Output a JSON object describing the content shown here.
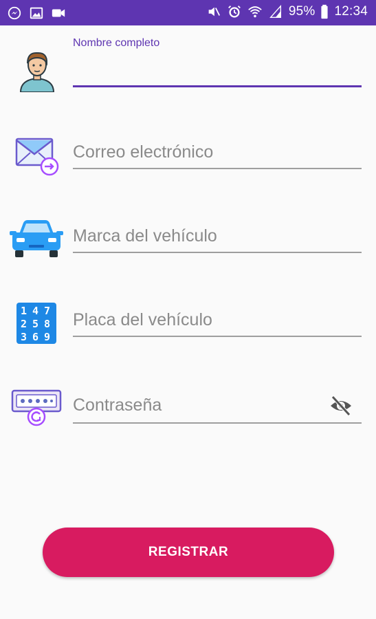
{
  "status_bar": {
    "battery": "95%",
    "time": "12:34",
    "left_icons": [
      "messenger-icon",
      "image-icon",
      "video-icon"
    ],
    "right_icons": [
      "mute-icon",
      "alarm-icon",
      "wifi-icon",
      "signal-icon",
      "battery-icon"
    ]
  },
  "form": {
    "full_name": {
      "label": "Nombre completo",
      "value": "",
      "icon": "person-avatar-icon"
    },
    "email": {
      "placeholder": "Correo electrónico",
      "value": "",
      "icon": "email-icon"
    },
    "vehicle_brand": {
      "placeholder": "Marca del vehículo",
      "value": "",
      "icon": "car-icon"
    },
    "vehicle_plate": {
      "placeholder": "Placa del vehículo",
      "value": "",
      "icon": "number-pad-icon"
    },
    "password": {
      "placeholder": "Contraseña",
      "value": "",
      "icon": "password-icon",
      "toggle_icon": "eye-off-icon"
    }
  },
  "register_button": {
    "label": "REGISTRAR"
  },
  "colors": {
    "status_bar": "#5e35b1",
    "accent": "#5e35b1",
    "button": "#d81b60",
    "background": "#fafafa"
  }
}
